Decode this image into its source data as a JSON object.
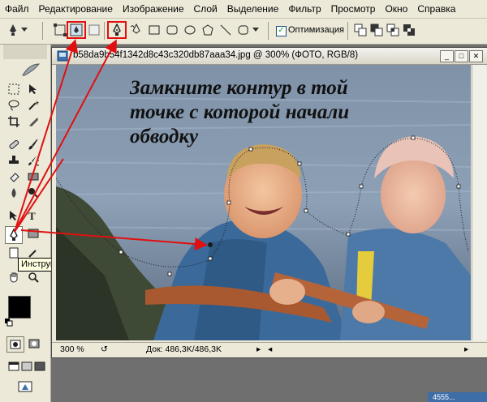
{
  "menu": {
    "items": [
      "Файл",
      "Редактирование",
      "Изображение",
      "Слой",
      "Выделение",
      "Фильтр",
      "Просмотр",
      "Окно",
      "Справка"
    ]
  },
  "options_bar": {
    "checkbox_label": "Оптимизация",
    "checkbox_checked": true
  },
  "tooltip": {
    "text": "Инструмент \"Перо\" (P)"
  },
  "document": {
    "title": "b58da9b54f1342d8c43c320db87aaa34.jpg @ 300% (ФОТО, RGB/8)",
    "zoom": "300 %",
    "doc_info": "Док: 486,3K/486,3K"
  },
  "annotation": {
    "line1": "Замкните контур в той",
    "line2": "точке с которой начали",
    "line3": "обводку"
  },
  "taskbar": {
    "label": "4555..."
  },
  "colors": {
    "highlight": "#e01010",
    "path": "#1a1a1a",
    "foreground": "#000000",
    "background": "#ffffff"
  }
}
